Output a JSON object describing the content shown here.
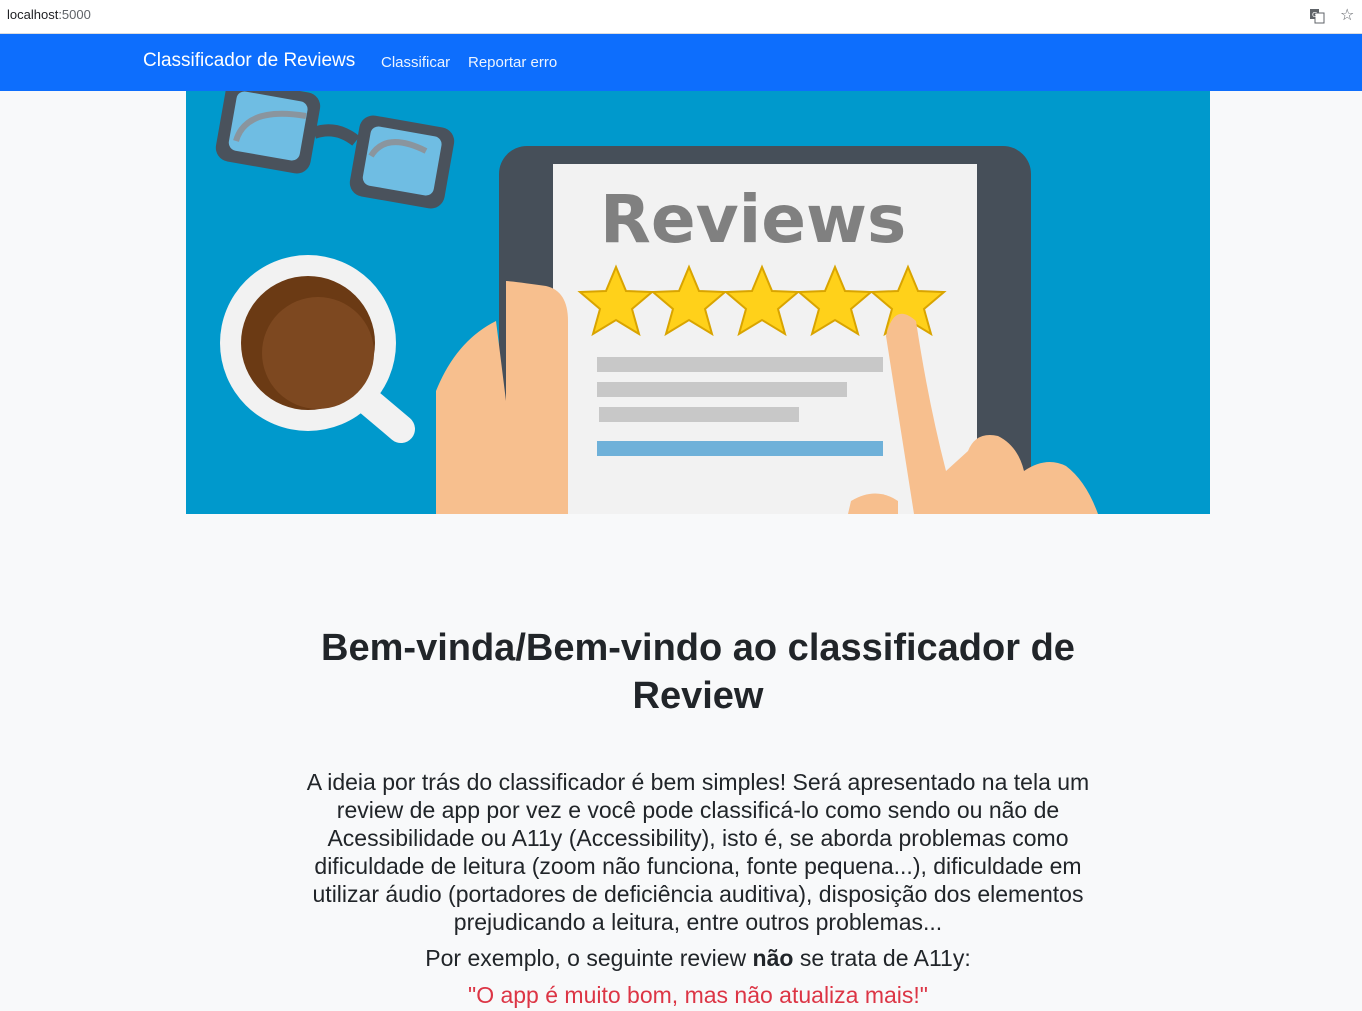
{
  "browser": {
    "url_host": "localhost",
    "url_port": ":5000"
  },
  "navbar": {
    "brand": "Classificador de Reviews",
    "links": [
      "Classificar",
      "Reportar erro"
    ],
    "color": "#0d6efd"
  },
  "hero": {
    "heading": "Reviews",
    "stars": 5,
    "background": "#0099cc"
  },
  "content": {
    "title": "Bem-vinda/Bem-vindo ao classificador de Review",
    "intro": "A ideia por trás do classificador é bem simples! Será apresentado na tela um review de app por vez e você pode classificá-lo como sendo ou não de Acessibilidade ou A11y (Accessibility), isto é, se aborda problemas como dificuldade de leitura (zoom não funciona, fonte pequena...), dificuldade em utilizar áudio (portadores de deficiência auditiva), disposição dos elementos prejudicando a leitura, entre outros problemas...",
    "example_before": "Por exemplo, o seguinte review ",
    "example_bold": "não",
    "example_after": " se trata de A11y:",
    "quote": "\"O app é muito bom, mas não atualiza mais!\"",
    "quote_color": "#dc3545"
  }
}
